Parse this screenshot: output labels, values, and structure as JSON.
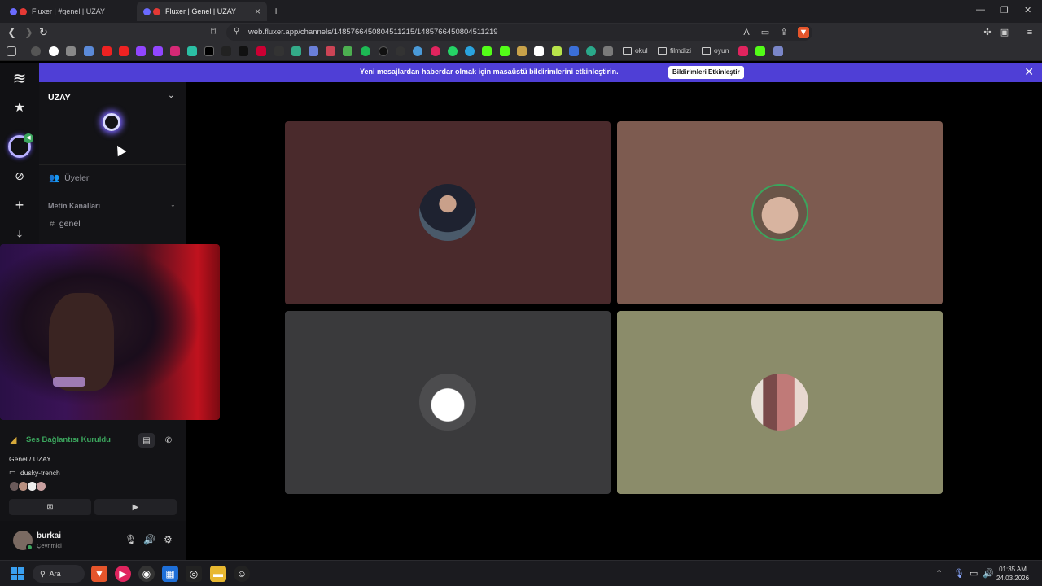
{
  "browser": {
    "tabs": [
      {
        "label": "Fluxer | #genel | UZAY"
      },
      {
        "label": "Fluxer | Genel | UZAY"
      }
    ],
    "url": "web.fluxer.app/channels/1485766450804511215/1485766450804511219",
    "bookmarks_folders": [
      "okul",
      "filmdizi",
      "oyun"
    ]
  },
  "banner": {
    "text": "Yeni mesajlardan haberdar olmak için masaüstü bildirimlerini etkinleştirin.",
    "button": "Bildirimleri Etkinleştir"
  },
  "sidebar": {
    "server_name": "UZAY",
    "members_label": "Üyeler",
    "text_channels_label": "Metin Kanalları",
    "channels": [
      "genel"
    ]
  },
  "voice": {
    "status": "Ses Bağlantısı Kuruldu",
    "location": "Genel / UZAY",
    "stream_name": "dusky-trench"
  },
  "user": {
    "name": "burkai",
    "status": "Çevrimiçi"
  },
  "video_tiles": [
    {
      "bg": "#4a2a2c",
      "avatar": "office-man"
    },
    {
      "bg": "#7d5b50",
      "avatar": "selfie",
      "speaking": true
    },
    {
      "bg": "#3a3a3c",
      "avatar": "white-cat"
    },
    {
      "bg": "#8b8c6a",
      "avatar": "blurred-photo"
    }
  ],
  "taskbar": {
    "search_label": "Ara",
    "time": "01:35 AM",
    "date": "24.03.2026"
  },
  "colors": {
    "accent": "#4f3fd6",
    "connected_green": "#3ba55d"
  }
}
